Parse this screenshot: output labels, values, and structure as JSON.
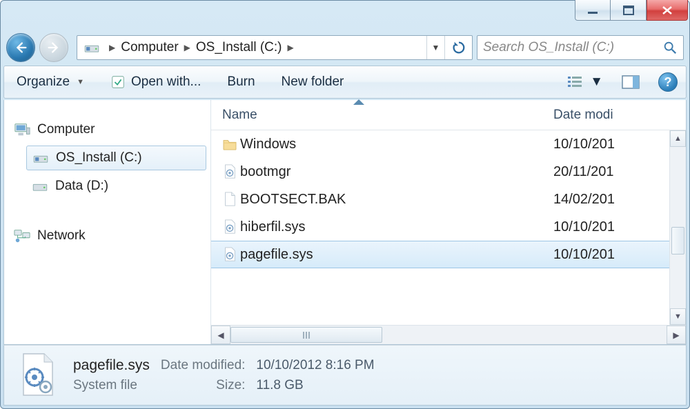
{
  "titlebar": {
    "minimize": "Minimize",
    "maximize": "Maximize",
    "close": "Close"
  },
  "address": {
    "crumbs": [
      "Computer",
      "OS_Install (C:)"
    ]
  },
  "search": {
    "placeholder": "Search OS_Install (C:)"
  },
  "toolbar": {
    "organize": "Organize",
    "open_with": "Open with...",
    "burn": "Burn",
    "new_folder": "New folder"
  },
  "navpane": {
    "computer": "Computer",
    "os_install": "OS_Install (C:)",
    "data": "Data (D:)",
    "network": "Network"
  },
  "columns": {
    "name": "Name",
    "date": "Date modi"
  },
  "files": [
    {
      "name": "Windows",
      "date": "10/10/201",
      "type": "folder",
      "selected": false
    },
    {
      "name": "bootmgr",
      "date": "20/11/201",
      "type": "sys",
      "selected": false
    },
    {
      "name": "BOOTSECT.BAK",
      "date": "14/02/201",
      "type": "file",
      "selected": false
    },
    {
      "name": "hiberfil.sys",
      "date": "10/10/201",
      "type": "sys",
      "selected": false
    },
    {
      "name": "pagefile.sys",
      "date": "10/10/201",
      "type": "sys",
      "selected": true
    }
  ],
  "details": {
    "filename": "pagefile.sys",
    "filetype": "System file",
    "date_label": "Date modified:",
    "date_value": "10/10/2012 8:16 PM",
    "size_label": "Size:",
    "size_value": "11.8 GB"
  }
}
